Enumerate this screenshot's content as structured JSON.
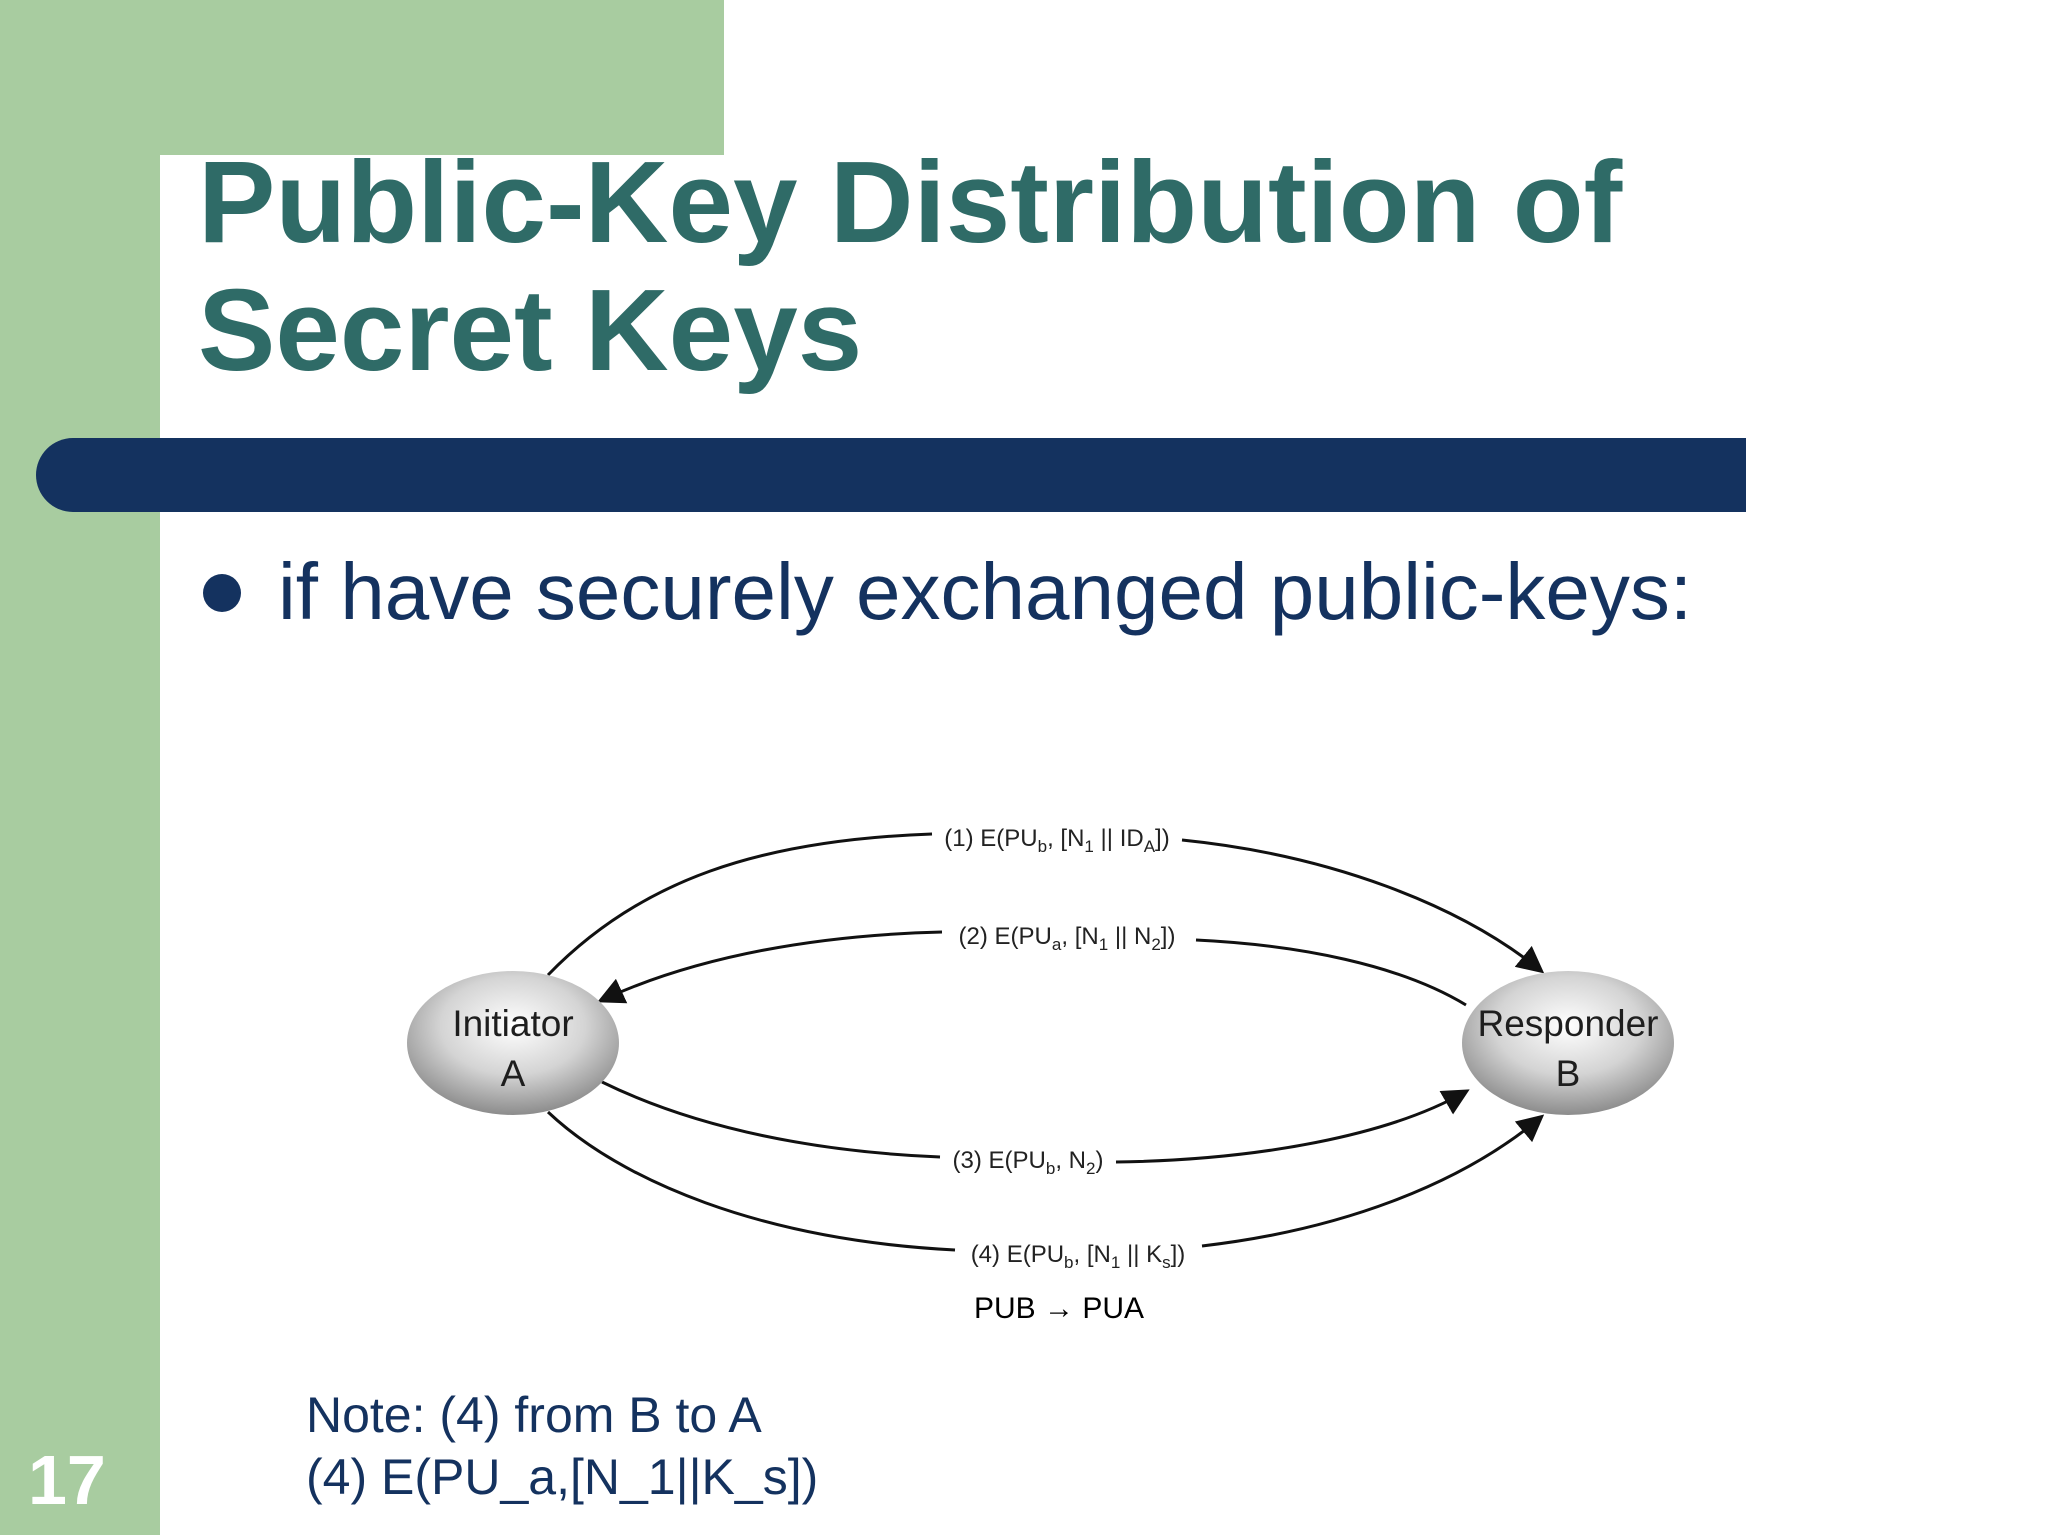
{
  "slide": {
    "title_line1": "Public-Key Distribution of",
    "title_line2": "Secret Keys",
    "bullet": "if have securely exchanged public-keys:",
    "note_line1": "Note: (4) from B to A",
    "note_line2": "(4) E(PU_a,[N_1||K_s])",
    "page_number": "17"
  },
  "diagram": {
    "initiator": {
      "line1": "Initiator",
      "line2": "A"
    },
    "responder": {
      "line1": "Responder",
      "line2": "B"
    },
    "messages": [
      {
        "step": "(1)",
        "text": "(1) E(PU_b, [N_1 || ID_A])",
        "direction": "A-to-B"
      },
      {
        "step": "(2)",
        "text": "(2) E(PU_a, [N_1 || N_2])",
        "direction": "B-to-A"
      },
      {
        "step": "(3)",
        "text": "(3) E(PU_b, N_2)",
        "direction": "A-to-B"
      },
      {
        "step": "(4)",
        "text": "(4) E(PU_b, [N_1 || K_s])",
        "direction": "A-to-B"
      }
    ],
    "annotation": "PUB → PUA"
  },
  "colors": {
    "green": "#a8cca0",
    "title": "#2f6b67",
    "navy": "#14325f"
  }
}
